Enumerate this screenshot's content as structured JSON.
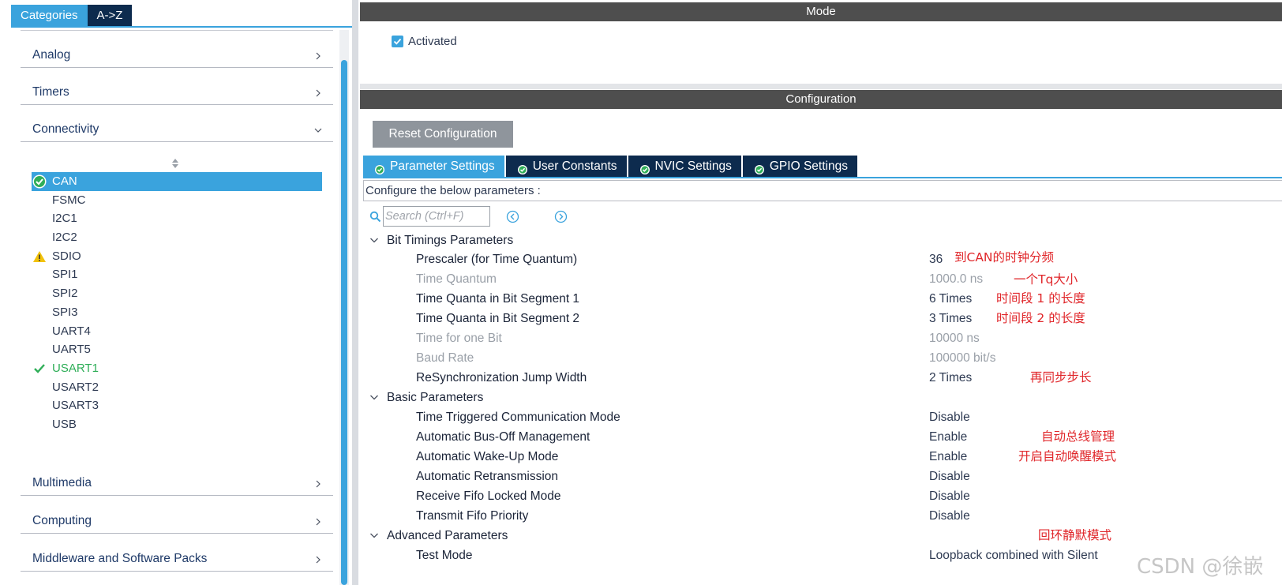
{
  "left_panel": {
    "tabs": [
      {
        "label": "Categories",
        "active": true
      },
      {
        "label": "A->Z",
        "active": false
      }
    ],
    "sections_top": [
      {
        "label": "Analog",
        "expanded": false
      },
      {
        "label": "Timers",
        "expanded": false
      },
      {
        "label": "Connectivity",
        "expanded": true
      }
    ],
    "peripherals": [
      {
        "label": "CAN",
        "status": "ok-selected"
      },
      {
        "label": "FSMC",
        "status": "none"
      },
      {
        "label": "I2C1",
        "status": "none"
      },
      {
        "label": "I2C2",
        "status": "none"
      },
      {
        "label": "SDIO",
        "status": "warning"
      },
      {
        "label": "SPI1",
        "status": "none"
      },
      {
        "label": "SPI2",
        "status": "none"
      },
      {
        "label": "SPI3",
        "status": "none"
      },
      {
        "label": "UART4",
        "status": "none"
      },
      {
        "label": "UART5",
        "status": "none"
      },
      {
        "label": "USART1",
        "status": "ok"
      },
      {
        "label": "USART2",
        "status": "none"
      },
      {
        "label": "USART3",
        "status": "none"
      },
      {
        "label": "USB",
        "status": "none"
      }
    ],
    "sections_bottom": [
      {
        "label": "Multimedia",
        "expanded": false
      },
      {
        "label": "Computing",
        "expanded": false
      },
      {
        "label": "Middleware and Software Packs",
        "expanded": false
      }
    ]
  },
  "mode": {
    "title": "Mode",
    "activated_label": "Activated",
    "activated_checked": true
  },
  "configuration": {
    "title": "Configuration",
    "reset_label": "Reset Configuration",
    "tabs": [
      {
        "label": "Parameter Settings",
        "active": true
      },
      {
        "label": "User Constants",
        "active": false
      },
      {
        "label": "NVIC Settings",
        "active": false
      },
      {
        "label": "GPIO Settings",
        "active": false
      }
    ],
    "configure_text": "Configure the below parameters :",
    "search_placeholder": "Search (Ctrl+F)",
    "groups": [
      {
        "name": "Bit Timings Parameters",
        "params": [
          {
            "name": "Prescaler (for Time Quantum)",
            "value": "36",
            "disabled": false
          },
          {
            "name": "Time Quantum",
            "value": "1000.0 ns",
            "disabled": true
          },
          {
            "name": "Time Quanta in Bit Segment 1",
            "value": "6 Times",
            "disabled": false
          },
          {
            "name": "Time Quanta in Bit Segment 2",
            "value": "3 Times",
            "disabled": false
          },
          {
            "name": "Time for one Bit",
            "value": "10000 ns",
            "disabled": true
          },
          {
            "name": "Baud Rate",
            "value": "100000 bit/s",
            "disabled": true
          },
          {
            "name": "ReSynchronization Jump Width",
            "value": "2 Times",
            "disabled": false
          }
        ]
      },
      {
        "name": "Basic Parameters",
        "params": [
          {
            "name": "Time Triggered Communication Mode",
            "value": "Disable",
            "disabled": false
          },
          {
            "name": "Automatic Bus-Off Management",
            "value": "Enable",
            "disabled": false
          },
          {
            "name": "Automatic Wake-Up Mode",
            "value": "Enable",
            "disabled": false
          },
          {
            "name": "Automatic Retransmission",
            "value": "Disable",
            "disabled": false
          },
          {
            "name": "Receive Fifo Locked Mode",
            "value": "Disable",
            "disabled": false
          },
          {
            "name": "Transmit Fifo Priority",
            "value": "Disable",
            "disabled": false
          }
        ]
      },
      {
        "name": "Advanced Parameters",
        "params": [
          {
            "name": "Test Mode",
            "value": "Loopback combined with Silent",
            "disabled": false
          }
        ]
      }
    ]
  },
  "annotations": [
    "到CAN的时钟分频",
    "一个Tq大小",
    "时间段 1 的长度",
    "时间段 2 的长度",
    "再同步步长",
    "自动总线管理",
    "开启自动唤醒模式",
    "回环静默模式"
  ],
  "watermark": "CSDN @徐嵌",
  "colors": {
    "accent": "#3aa3dd",
    "navy": "#0d2b4e",
    "band": "#4e4e4e",
    "annotation": "#e0262a",
    "ok_green": "#2fae58",
    "warning_yellow": "#f2c20a"
  }
}
